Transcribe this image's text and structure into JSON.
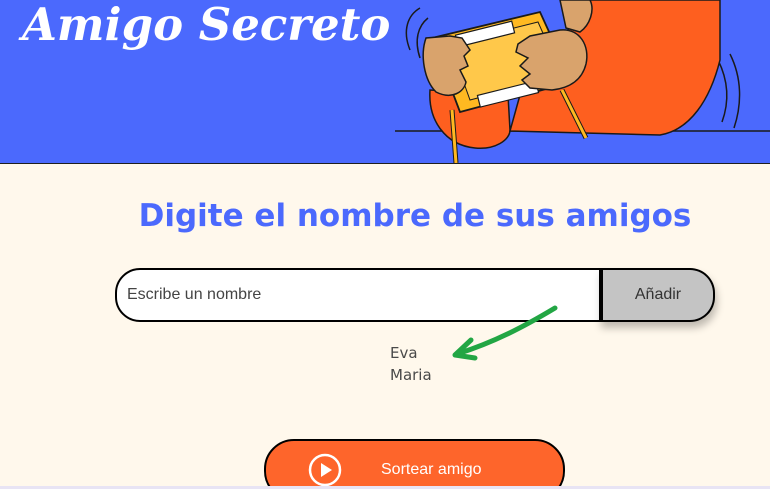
{
  "header": {
    "title": "Amigo Secreto",
    "illustration": "person-holding-game-console-illustration"
  },
  "main": {
    "heading": "Digite el nombre de sus amigos",
    "input": {
      "placeholder": "Escribe un nombre",
      "value": ""
    },
    "add_button_label": "Añadir",
    "friends": [
      "Eva",
      "Maria"
    ],
    "annotation": "green-arrow-annotation",
    "draw_button": {
      "label": "Sortear amigo",
      "icon": "play-circle-icon"
    }
  },
  "colors": {
    "header_bg": "#4B69FD",
    "heading": "#4B69FD",
    "page_bg": "#FFF8EC",
    "add_button_bg": "#C4C4C4",
    "draw_button_bg": "#FE652B",
    "arrow": "#22A644"
  }
}
